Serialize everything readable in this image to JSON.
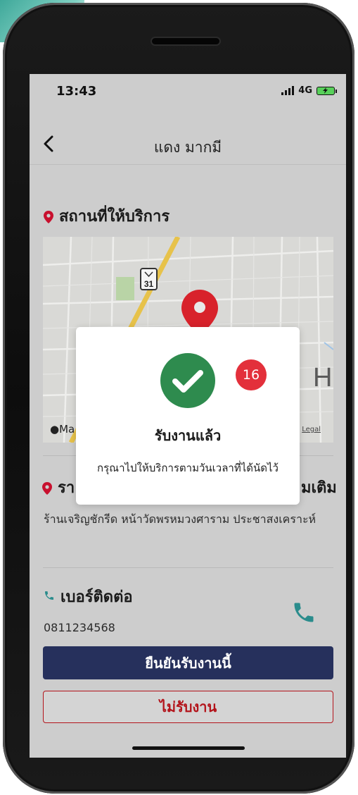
{
  "status_bar": {
    "time": "13:43",
    "network": "4G"
  },
  "nav": {
    "title": "แดง มากมี"
  },
  "service_location": {
    "heading": "สถานที่ให้บริการ"
  },
  "map": {
    "route_shield": "31",
    "attribution": "Ma",
    "legal": "Legal",
    "edge_letter": "H"
  },
  "address_section": {
    "heading_start": "รา",
    "heading_end": "มเติม",
    "address": "ร้านเจริญชักรีด หน้าวัดพรหมวงศาราม ประชาสงเคราะห์"
  },
  "contact": {
    "heading": "เบอร์ติดต่อ",
    "phone": "0811234568"
  },
  "actions": {
    "confirm_label": "ยืนยันรับงานนี้",
    "reject_label": "ไม่รับงาน"
  },
  "dialog": {
    "badge_count": "16",
    "title": "รับงานแล้ว",
    "message": "กรุณาไปให้บริการตามวันเวลาที่ได้นัดไว้"
  },
  "colors": {
    "primary": "#26305c",
    "danger": "#b3141b",
    "success": "#2e8b4e",
    "badge": "#e3303b",
    "pin": "#c8102e",
    "phone_icon": "#2a8c8c"
  }
}
